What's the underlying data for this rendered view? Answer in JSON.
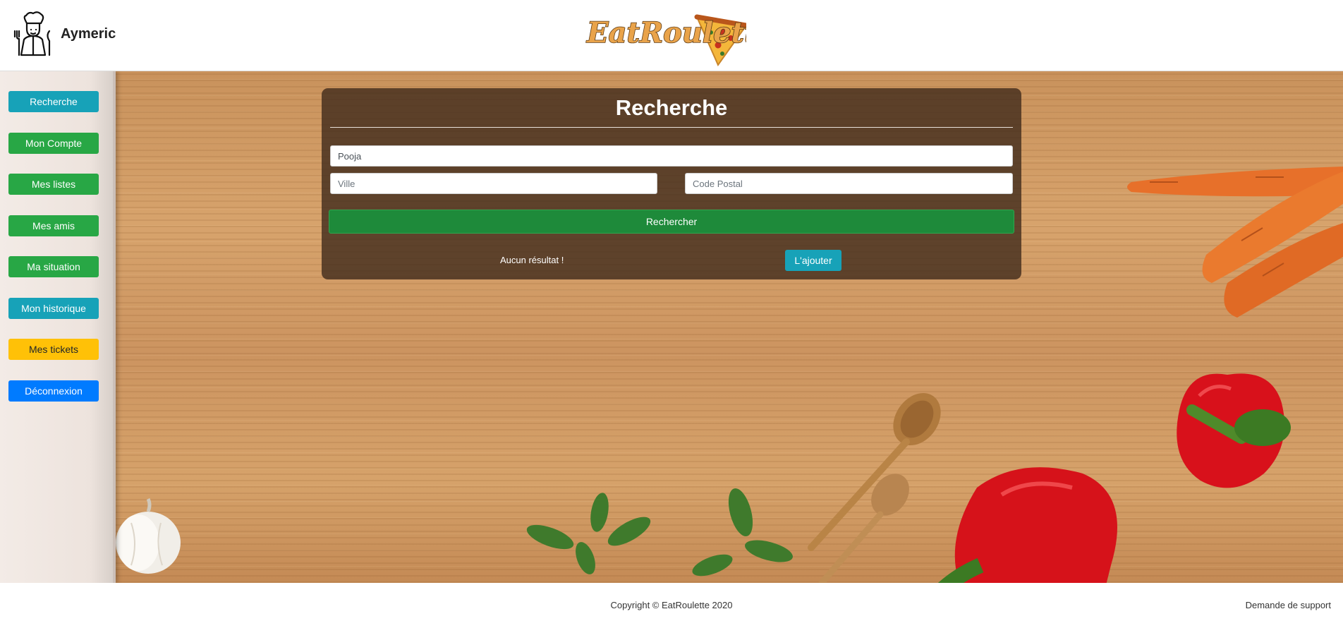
{
  "header": {
    "user_name": "Aymeric",
    "logo_text": "EatRoulette"
  },
  "sidebar": {
    "items": [
      {
        "label": "Recherche",
        "color": "#17a2b8"
      },
      {
        "label": "Mon Compte",
        "color": "#28a745"
      },
      {
        "label": "Mes listes",
        "color": "#28a745"
      },
      {
        "label": "Mes amis",
        "color": "#28a745"
      },
      {
        "label": "Ma situation",
        "color": "#28a745"
      },
      {
        "label": "Mon historique",
        "color": "#17a2b8"
      },
      {
        "label": "Mes tickets",
        "color": "#ffc107"
      },
      {
        "label": "Déconnexion",
        "color": "#007bff"
      }
    ]
  },
  "search": {
    "title": "Recherche",
    "name_value": "Pooja",
    "city_placeholder": "Ville",
    "postal_placeholder": "Code Postal",
    "submit_label": "Rechercher",
    "no_result_text": "Aucun résultat !",
    "add_label": "L'ajouter"
  },
  "footer": {
    "copyright": "Copyright © EatRoulette 2020",
    "support_link": "Demande de support"
  }
}
